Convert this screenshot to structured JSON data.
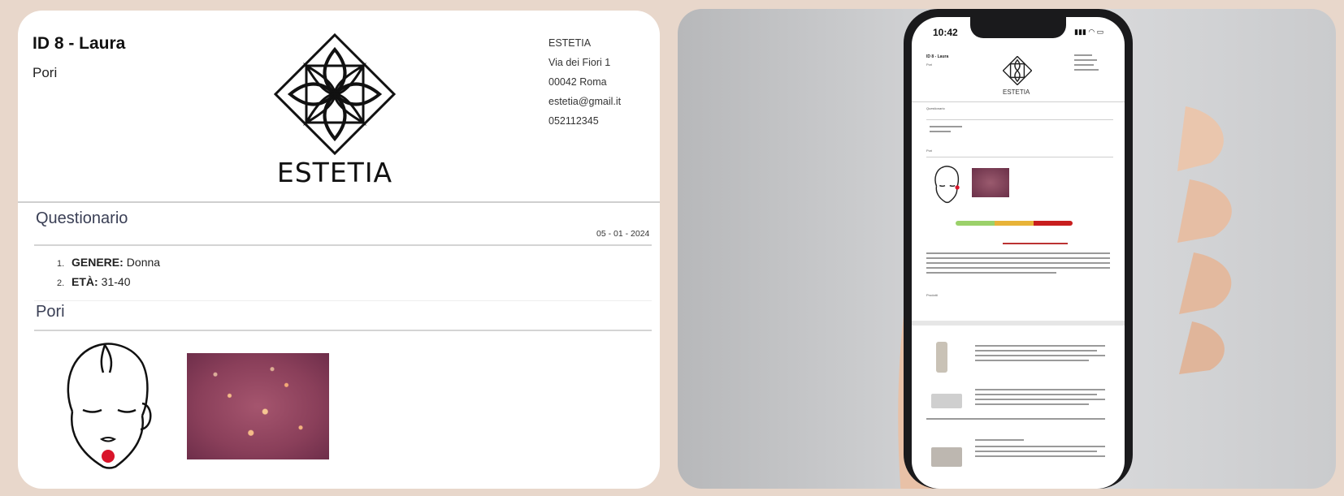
{
  "document": {
    "title": "ID 8 - Laura",
    "subtitle": "Pori",
    "logo_text": "ESTETIA",
    "company": {
      "name": "ESTETIA",
      "address": "Via dei Fiori 1",
      "city": "00042 Roma",
      "email": "estetia@gmail.it",
      "phone": "052112345"
    },
    "questionnaire": {
      "title": "Questionario",
      "date": "05 - 01 - 2024",
      "items": [
        {
          "num": "1.",
          "question": "GENERE:",
          "answer": "Donna"
        },
        {
          "num": "2.",
          "question": "ETÀ:",
          "answer": "31-40"
        }
      ]
    },
    "pores": {
      "title": "Pori"
    }
  },
  "phone": {
    "time": "10:42",
    "status": "▮▮▮ ◠ ▭",
    "doc_title": "ID 8 - Laura",
    "doc_subtitle": "Pori",
    "logo_text": "ESTETIA",
    "section_questionnaire": "Questionario",
    "section_pores": "Pori",
    "section_products": "Prodotti"
  },
  "colors": {
    "background": "#e8d7cb",
    "card": "#ffffff",
    "section_title": "#3a3f55",
    "marker": "#d9142a",
    "scale_green": "#9bd16a",
    "scale_yellow": "#e8b338",
    "scale_red": "#c81e1e"
  },
  "icons": [
    "estetia-logo-icon",
    "face-icon",
    "signal-icon",
    "wifi-icon",
    "battery-icon"
  ]
}
